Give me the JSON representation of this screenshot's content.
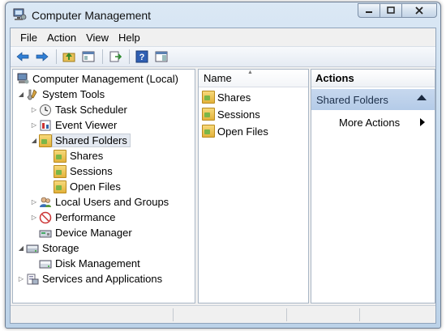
{
  "window": {
    "title": "Computer Management"
  },
  "menu": [
    "File",
    "Action",
    "View",
    "Help"
  ],
  "tree": {
    "root": "Computer Management (Local)",
    "system_tools": "System Tools",
    "task_scheduler": "Task Scheduler",
    "event_viewer": "Event Viewer",
    "shared_folders": "Shared Folders",
    "shares": "Shares",
    "sessions": "Sessions",
    "open_files": "Open Files",
    "local_users": "Local Users and Groups",
    "performance": "Performance",
    "device_manager": "Device Manager",
    "storage": "Storage",
    "disk_management": "Disk Management",
    "services": "Services and Applications"
  },
  "list": {
    "header": "Name",
    "items": [
      "Shares",
      "Sessions",
      "Open Files"
    ]
  },
  "actions": {
    "header": "Actions",
    "section": "Shared Folders",
    "more": "More Actions"
  },
  "colors": {
    "accent": "#b4cbe8",
    "title_bar": "#c9dcee"
  }
}
